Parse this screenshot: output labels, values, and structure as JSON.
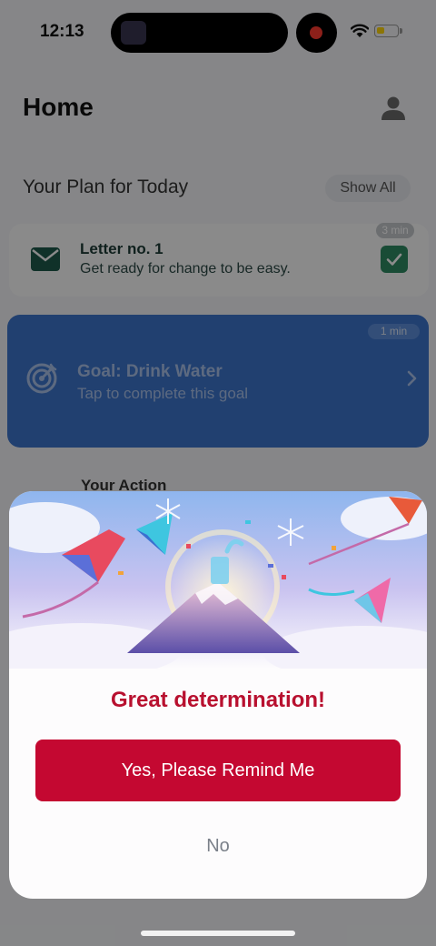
{
  "status_bar": {
    "time": "12:13",
    "battery_level": 0.4,
    "battery_color": "#ffd60a",
    "recording_color": "#ff3b30"
  },
  "header": {
    "title": "Home",
    "profile_icon": "person-icon"
  },
  "plan": {
    "section_title": "Your Plan for Today",
    "show_all_label": "Show All",
    "items": [
      {
        "title": "Letter no. 1",
        "subtitle": "Get ready for change to be easy.",
        "duration": "3 min",
        "icon": "envelope-icon",
        "completed": true
      },
      {
        "title": "Goal: Drink Water",
        "subtitle": "Tap to complete this goal",
        "duration": "1 min",
        "icon": "target-icon",
        "accent": "#3d75cc"
      }
    ],
    "next_section": "Your Action"
  },
  "sheet": {
    "illustration": "celebration-kites-mountain-illustration",
    "heading": "Great determination!",
    "primary_label": "Yes, Please Remind Me",
    "secondary_label": "No",
    "accent": "#c40831"
  }
}
